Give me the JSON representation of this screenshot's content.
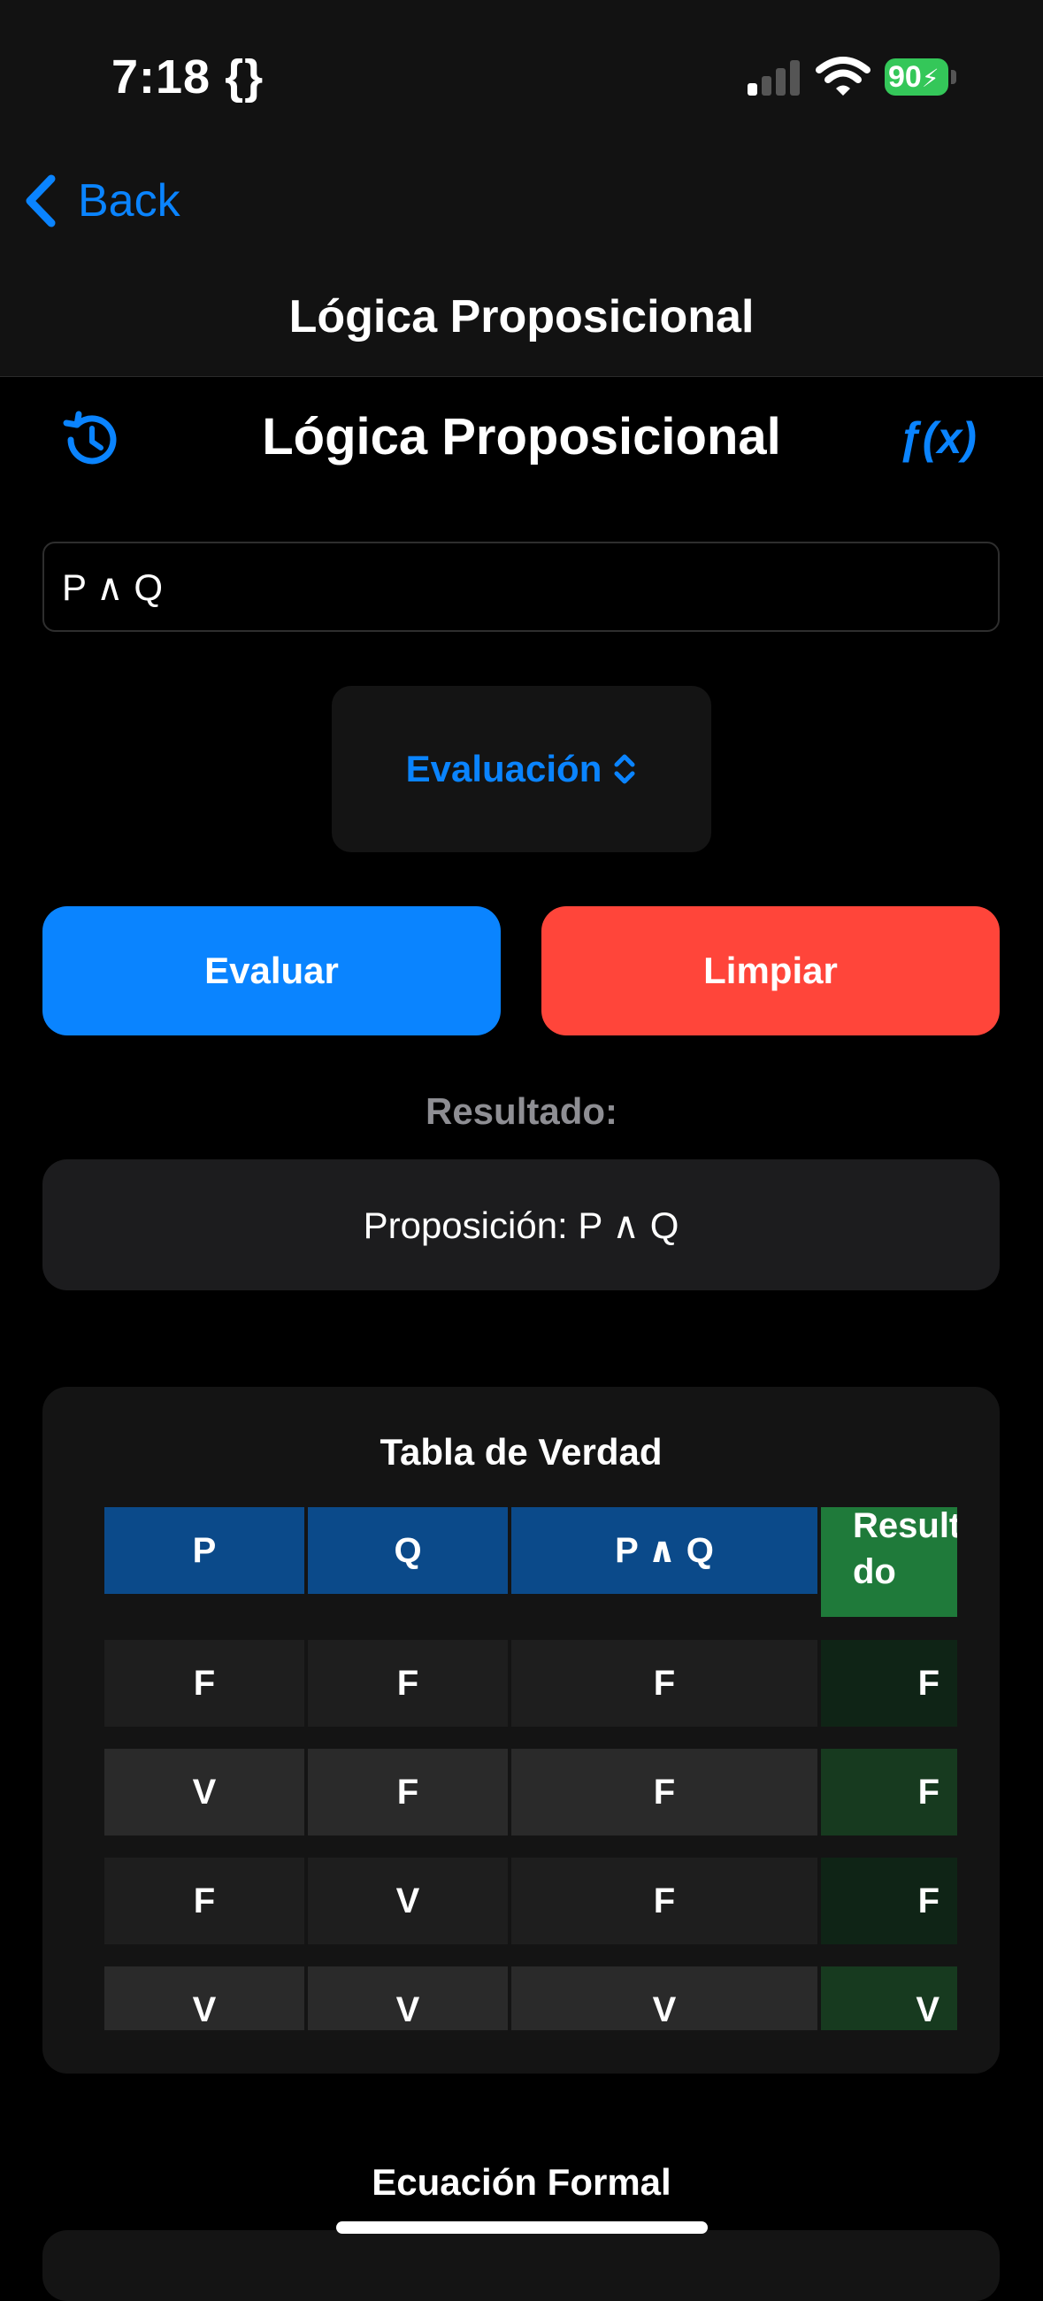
{
  "status_bar": {
    "time": "7:18 {}",
    "battery": "90"
  },
  "nav": {
    "back_label": "Back",
    "title": "Lógica Proposicional"
  },
  "header": {
    "title": "Lógica Proposicional",
    "fx_label": "ƒ(x)"
  },
  "input": {
    "value": "P ∧ Q"
  },
  "mode_picker": {
    "selected": "Evaluación"
  },
  "buttons": {
    "evaluate": "Evaluar",
    "clear": "Limpiar"
  },
  "result": {
    "label": "Resultado:",
    "text": "Proposición: P ∧ Q"
  },
  "truth_table": {
    "title": "Tabla de Verdad",
    "headers": [
      "P",
      "Q",
      "P ∧ Q",
      "Result do"
    ],
    "rows": [
      [
        "F",
        "F",
        "F",
        "F"
      ],
      [
        "V",
        "F",
        "F",
        "F"
      ],
      [
        "F",
        "V",
        "F",
        "F"
      ],
      [
        "V",
        "V",
        "V",
        "V"
      ]
    ]
  },
  "formal_equation": {
    "title": "Ecuación Formal"
  },
  "colors": {
    "accent": "#0a84ff",
    "danger": "#ff453a",
    "header_blue": "#0b4a8a",
    "result_green": "#1f7a3a"
  }
}
